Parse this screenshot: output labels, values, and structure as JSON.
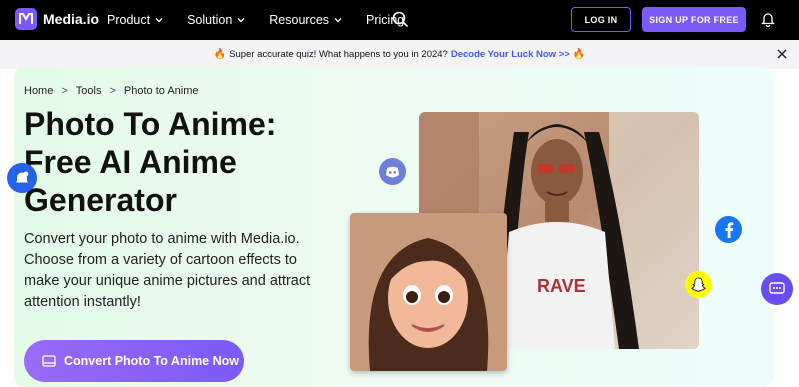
{
  "nav": {
    "logo_text": "Media.io",
    "items": [
      {
        "label": "Product",
        "has_dropdown": true
      },
      {
        "label": "Solution",
        "has_dropdown": true
      },
      {
        "label": "Resources",
        "has_dropdown": true
      },
      {
        "label": "Pricing",
        "has_dropdown": false
      }
    ],
    "login_label": "LOG IN",
    "signup_label": "SIGN UP FOR FREE"
  },
  "promo": {
    "text": "Super accurate quiz! What happens to you in 2024?",
    "link": "Decode Your Luck Now >>"
  },
  "breadcrumb": {
    "home": "Home",
    "sep1": ">",
    "tools": "Tools",
    "sep2": ">",
    "current": "Photo to Anime"
  },
  "hero": {
    "title": "Photo To Anime: Free AI Anime Generator",
    "description": "Convert your photo to anime with Media.io. Choose from a variety of cartoon effects to make your unique anime pictures and attract attention instantly!",
    "cta_label": "Convert Photo To Anime Now"
  },
  "colors": {
    "brand": "#7a5af8",
    "link": "#3d5afe",
    "nav_bg": "#000000"
  },
  "icons": [
    "logo-icon",
    "chevron-down-icon",
    "search-icon",
    "bell-icon",
    "fire-icon",
    "close-icon",
    "notification-icon",
    "image-icon",
    "discord-icon",
    "facebook-icon",
    "snapchat-icon",
    "chat-icon"
  ]
}
